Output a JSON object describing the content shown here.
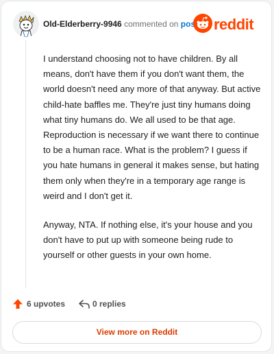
{
  "comment": {
    "username": "Old-Elderberry-9946",
    "action_text": "commented on",
    "post_link": "post",
    "paragraphs": [
      "I understand choosing not to have children. By all means, don't have them if you don't want them, the world doesn't need any more of that anyway. But active child-hate baffles me. They're just tiny humans doing what tiny humans do. We all used to be that age. Reproduction is necessary if we want there to continue to be a human race. What is the problem? I guess if you hate humans in general it makes sense, but hating them only when they're in a temporary age range is weird and I don't get it.",
      "Anyway, NTA. If nothing else, it's your house and you don't have to put up with someone being rude to yourself or other guests in your own home."
    ]
  },
  "brand": {
    "wordmark": "reddit",
    "icon": "reddit-snoo-icon",
    "color": "#ff4500"
  },
  "actions": {
    "upvotes": "6 upvotes",
    "replies": "0 replies",
    "upvote_icon": "upvote-arrow-icon",
    "reply_icon": "reply-arrow-icon"
  },
  "footer": {
    "view_more_label": "View more on Reddit"
  }
}
